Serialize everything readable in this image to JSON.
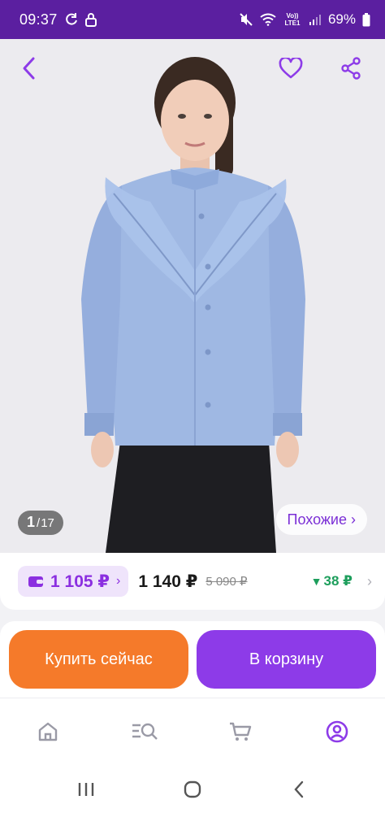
{
  "status_bar": {
    "time": "09:37",
    "network": "Vo)) LTE1",
    "battery": "69%"
  },
  "product": {
    "image_counter": {
      "current": "1",
      "separator": "/",
      "total": "17"
    },
    "similar_label": "Похожие ›",
    "wallet_price": "1 105 ₽",
    "price": "1 140 ₽",
    "old_price": "5 090 ₽",
    "price_change": "38 ₽",
    "price_change_arrow": "▼"
  },
  "actions": {
    "buy_now": "Купить сейчас",
    "add_to_cart": "В корзину"
  },
  "tabs": [
    {
      "icon": "home-icon"
    },
    {
      "icon": "catalog-search-icon"
    },
    {
      "icon": "cart-icon"
    },
    {
      "icon": "profile-icon",
      "active": true
    }
  ],
  "colors": {
    "status_bar": "#5b1fa0",
    "accent": "#8d3be8",
    "buy_button": "#f57a2a",
    "price_down": "#1d9e5c"
  }
}
